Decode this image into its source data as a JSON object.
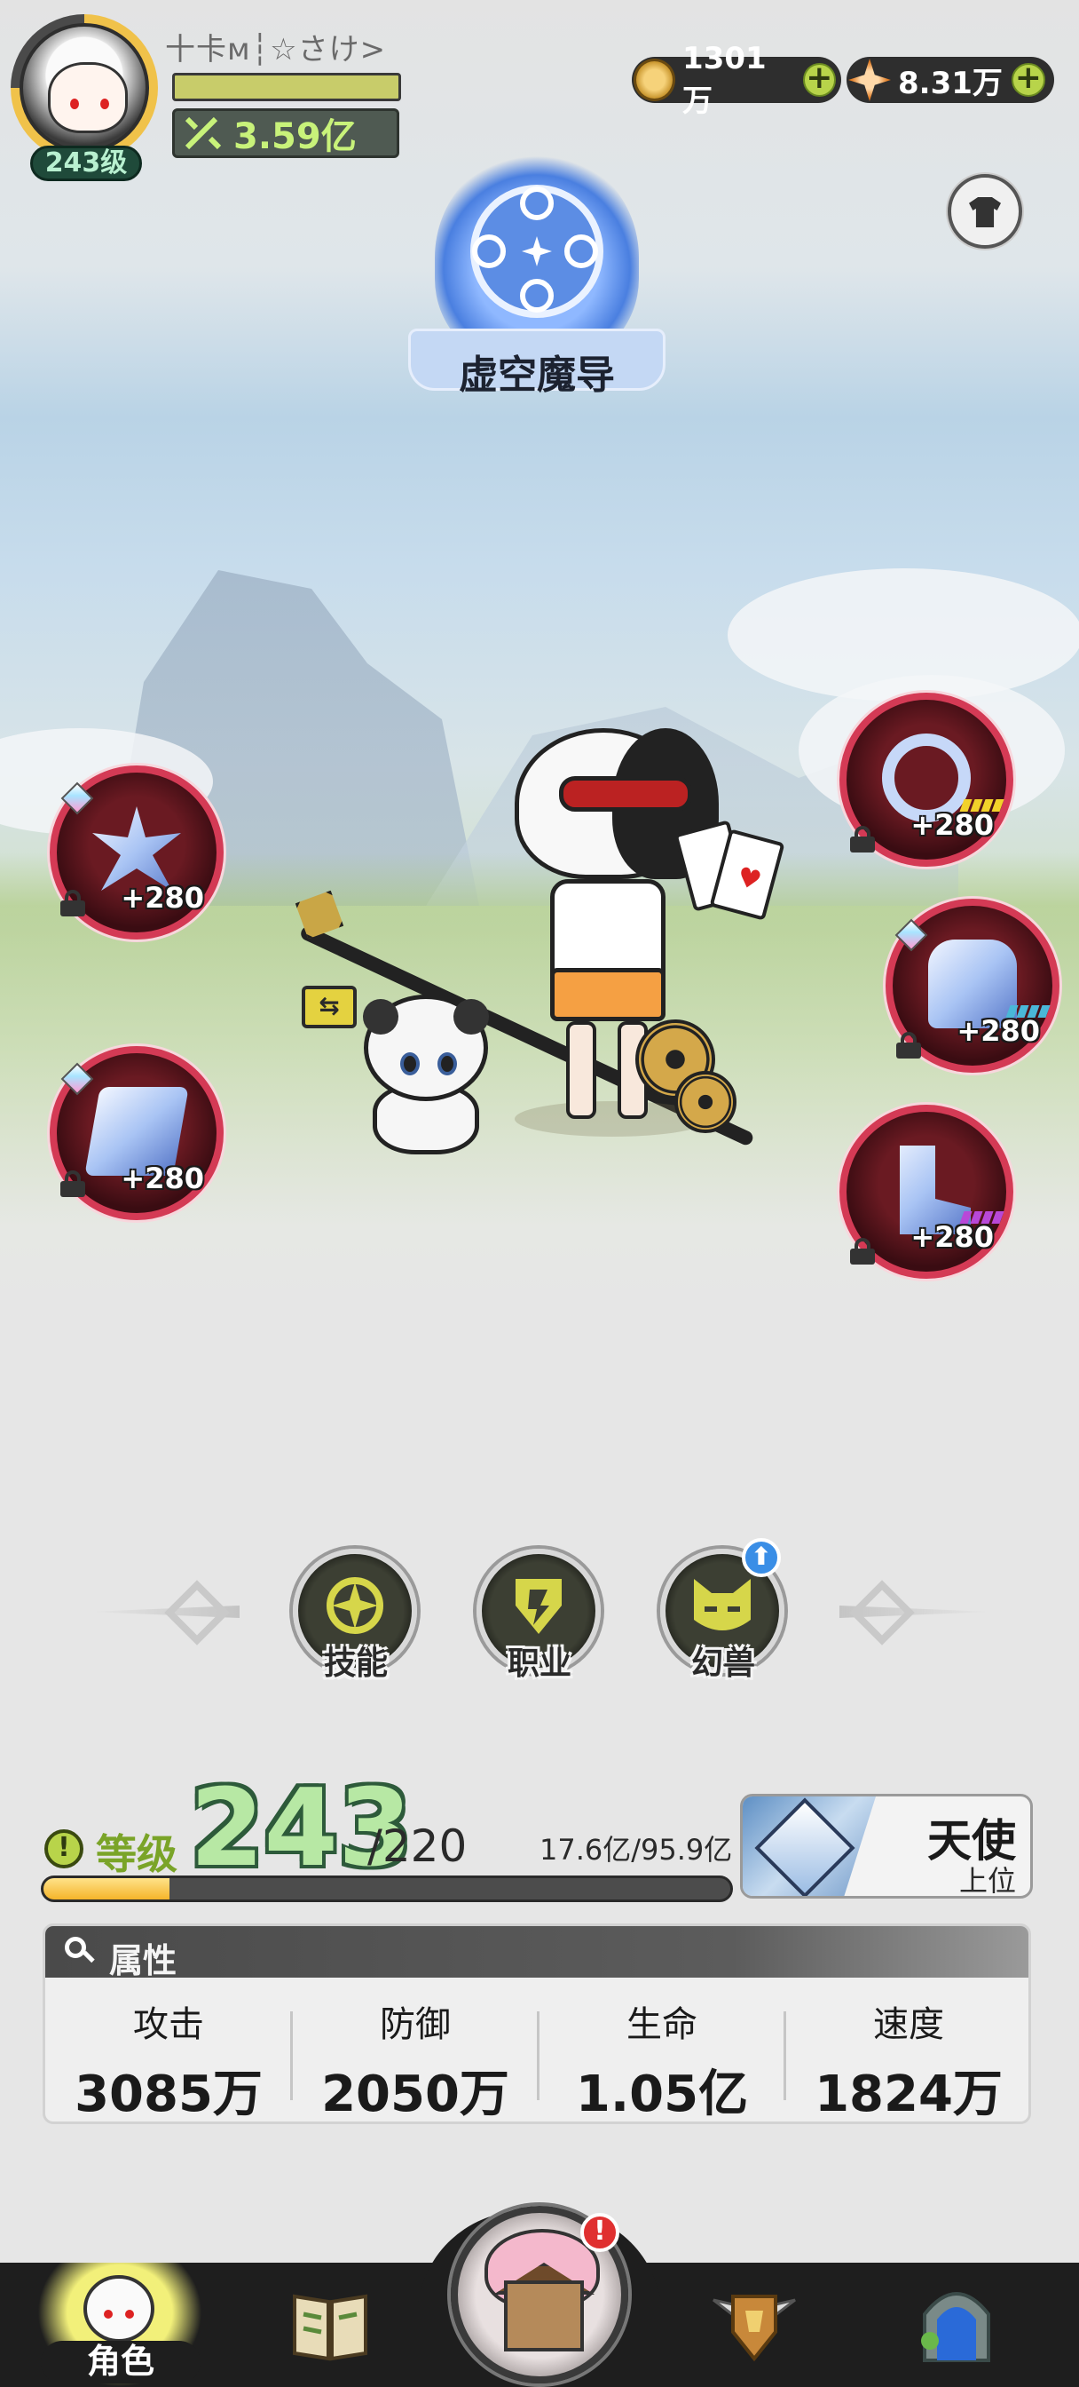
{
  "player": {
    "name": "十卡ᴍ┆☆さけ>",
    "level_badge": "243级",
    "power": "3.59亿"
  },
  "currencies": [
    {
      "icon": "gold-coin-icon",
      "amount": "1301万"
    },
    {
      "icon": "crystal-star-icon",
      "amount": "8.31万"
    }
  ],
  "class": {
    "title": "虚空魔导"
  },
  "equipment": {
    "left": [
      {
        "name": "snowflake-weapon",
        "enhance": "+280"
      },
      {
        "name": "spellbook",
        "enhance": "+280"
      }
    ],
    "right": [
      {
        "name": "crystal-ring",
        "enhance": "+280"
      },
      {
        "name": "crystal-armor",
        "enhance": "+280"
      },
      {
        "name": "crystal-boots",
        "enhance": "+280"
      }
    ]
  },
  "features": [
    {
      "label": "技能",
      "icon": "skill-emblem-icon"
    },
    {
      "label": "职业",
      "icon": "class-emblem-icon"
    },
    {
      "label": "幻兽",
      "icon": "beast-cat-icon"
    }
  ],
  "level": {
    "label": "等级",
    "current": "243",
    "max": "/220",
    "exp": "17.6亿/95.9亿",
    "exp_fraction": 0.184
  },
  "rank": {
    "name": "天使",
    "sub": "上位"
  },
  "attributes": {
    "title": "属性",
    "items": [
      {
        "name": "攻击",
        "value": "3085万"
      },
      {
        "name": "防御",
        "value": "2050万"
      },
      {
        "name": "生命",
        "value": "1.05亿"
      },
      {
        "name": "速度",
        "value": "1824万"
      }
    ]
  },
  "nav": {
    "active_label": "角色",
    "alert": "!",
    "upgrade": "⬆"
  },
  "colors": {
    "accent_green": "#b8d44a",
    "slot_ring": "#d43a55",
    "level_text": "#b7e8a4",
    "nav_bg": "#1e1e1e"
  }
}
